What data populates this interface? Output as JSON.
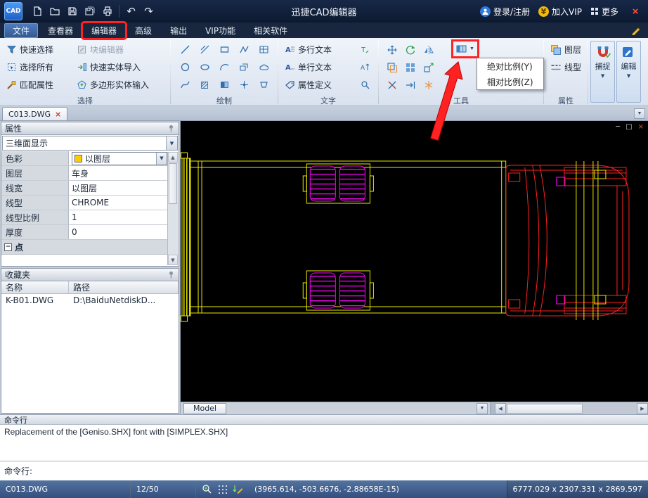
{
  "titlebar": {
    "logo": "CAD",
    "title": "迅捷CAD编辑器",
    "login": "登录/注册",
    "vip": "加入VIP",
    "more": "更多"
  },
  "menubar": {
    "items": [
      {
        "label": "文件"
      },
      {
        "label": "查看器"
      },
      {
        "label": "编辑器"
      },
      {
        "label": "高级"
      },
      {
        "label": "输出"
      },
      {
        "label": "VIP功能"
      },
      {
        "label": "相关软件"
      }
    ]
  },
  "ribbon": {
    "selection": {
      "label": "选择",
      "items": [
        "快速选择",
        "块编辑器",
        "选择所有",
        "快速实体导入",
        "匹配属性",
        "多边形实体输入"
      ]
    },
    "draw": {
      "label": "绘制"
    },
    "text": {
      "label": "文字",
      "items": [
        "多行文本",
        "单行文本",
        "属性定义"
      ]
    },
    "tools": {
      "label": "工具"
    },
    "props": {
      "label": "属性",
      "items": [
        "图层",
        "线型"
      ]
    },
    "snap": "捕捉",
    "edit": "编辑"
  },
  "scale_menu": {
    "items": [
      "绝对比例(Y)",
      "相对比例(Z)"
    ]
  },
  "tabs": {
    "active": "C013.DWG"
  },
  "properties_panel": {
    "title": "属性",
    "selector": "三维面显示",
    "rows": [
      {
        "label": "色彩",
        "value": "以图层"
      },
      {
        "label": "图层",
        "value": "车身"
      },
      {
        "label": "线宽",
        "value": "以图层"
      },
      {
        "label": "线型",
        "value": "CHROME"
      },
      {
        "label": "线型比例",
        "value": "1"
      },
      {
        "label": "厚度",
        "value": "0"
      }
    ],
    "section": "点"
  },
  "favorites_panel": {
    "title": "收藏夹",
    "col_name": "名称",
    "col_path": "路径",
    "rows": [
      {
        "name": "K-B01.DWG",
        "path": "D:\\BaiduNetdiskD..."
      }
    ]
  },
  "canvas": {
    "model_tab": "Model"
  },
  "command": {
    "title": "命令行",
    "output": "Replacement of the [Geniso.SHX] font with [SIMPLEX.SHX]",
    "prompt": "命令行:"
  },
  "statusbar": {
    "file": "C013.DWG",
    "progress": "12/50",
    "coords": "(3965.614, -503.6676, -2.88658E-15)",
    "extents": "6777.029 x 2307.331 x 2869.597"
  },
  "icons": {
    "close": "×",
    "minimize": "─",
    "restore": "□",
    "undo": "↶",
    "redo": "↷",
    "yen": "¥",
    "dropdown": "▼",
    "up": "▲",
    "down": "▼",
    "left": "◀",
    "right": "▶",
    "collapse": "−"
  },
  "colors": {
    "highlight_red": "#ff2222",
    "layer_swatch": "#ffcc00",
    "canvas_yellow": "#e8e800",
    "canvas_magenta": "#ff00ff",
    "canvas_red": "#ff2020"
  }
}
